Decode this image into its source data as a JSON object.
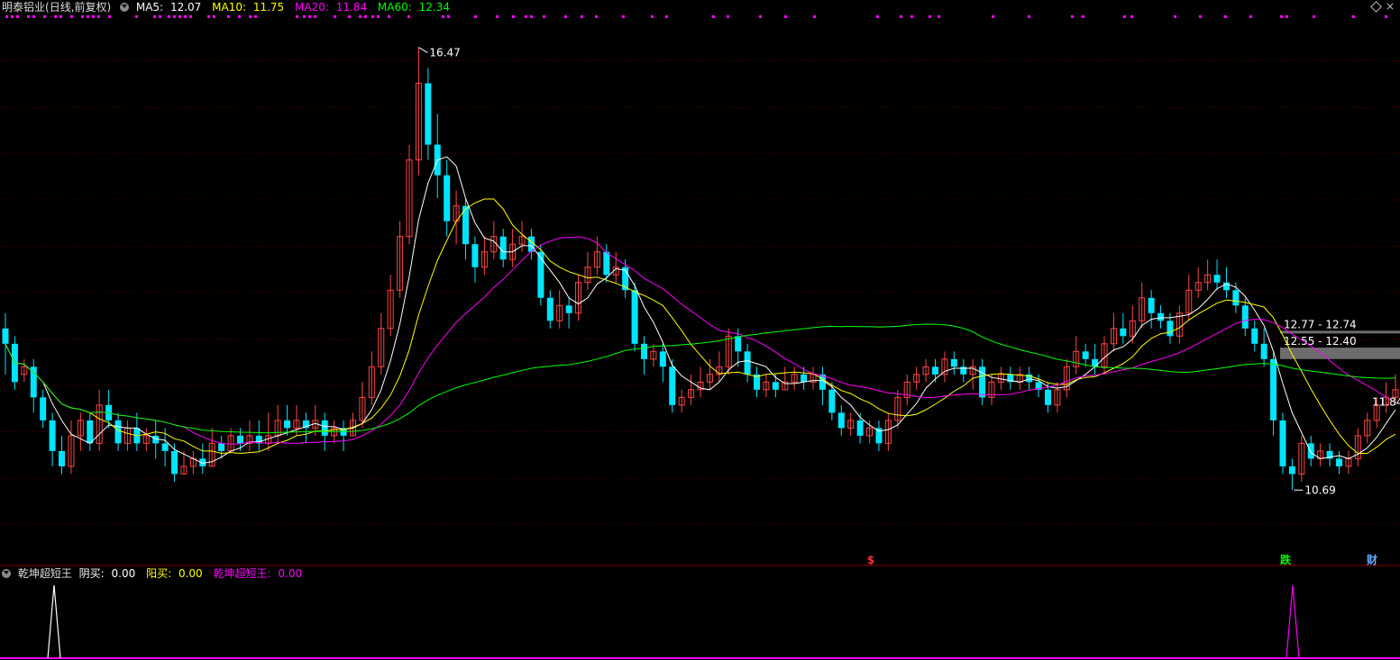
{
  "header": {
    "stock_name": "明泰铝业",
    "period": "(日线,前复权)",
    "ma5": {
      "label": "MA5:",
      "value": "12.07",
      "color": "#ffffff"
    },
    "ma10": {
      "label": "MA10:",
      "value": "11.75",
      "color": "#ffff00"
    },
    "ma20": {
      "label": "MA20:",
      "value": "11.84",
      "color": "#ff00ff"
    },
    "ma60": {
      "label": "MA60:",
      "value": "12.34",
      "color": "#00ff00"
    }
  },
  "indicator_header": {
    "name": "乾坤超短王",
    "yinmai": {
      "label": "阴买:",
      "value": "0.00",
      "color": "#ffffff"
    },
    "yangmai": {
      "label": "阳买:",
      "value": "0.00",
      "color": "#ffff00"
    },
    "qkcdw": {
      "label": "乾坤超短王:",
      "value": "0.00",
      "color": "#ff00ff"
    }
  },
  "colors": {
    "up": "#ff4444",
    "down": "#00e5ff",
    "grid": "#5a0000",
    "ma5": "#ffffff",
    "ma10": "#ffff00",
    "ma20": "#ff00ff",
    "ma60": "#00ff00",
    "dots": "#ff00ff",
    "zone": "#808080"
  },
  "chart_data": {
    "type": "candlestick",
    "y_range": [
      9.8,
      16.9
    ],
    "high_label": "16.47",
    "low_label": "10.69",
    "last_label": "11.84",
    "price_zones": [
      {
        "label": "12.77 - 12.74",
        "top": 12.77,
        "bottom": 12.74
      },
      {
        "label": "12.55 - 12.40",
        "top": 12.55,
        "bottom": 12.4
      }
    ],
    "event_markers": [
      {
        "text": "$",
        "color": "#ff3030"
      },
      {
        "text": "跌",
        "color": "#00ff00"
      },
      {
        "text": "财",
        "color": "#66aaff"
      }
    ],
    "candles": [
      [
        12.8,
        12.6,
        13.0,
        12.2
      ],
      [
        12.6,
        12.1,
        12.7,
        12.0
      ],
      [
        12.2,
        12.3,
        12.4,
        12.1
      ],
      [
        12.3,
        11.9,
        12.4,
        11.7
      ],
      [
        11.9,
        11.6,
        12.0,
        11.5
      ],
      [
        11.6,
        11.2,
        11.7,
        11.0
      ],
      [
        11.2,
        11.0,
        11.4,
        10.9
      ],
      [
        11.0,
        11.4,
        11.6,
        10.9
      ],
      [
        11.4,
        11.6,
        11.7,
        11.2
      ],
      [
        11.6,
        11.3,
        11.7,
        11.2
      ],
      [
        11.3,
        11.8,
        12.0,
        11.2
      ],
      [
        11.8,
        11.6,
        12.0,
        11.5
      ],
      [
        11.6,
        11.3,
        11.7,
        11.2
      ],
      [
        11.3,
        11.5,
        11.6,
        11.2
      ],
      [
        11.5,
        11.3,
        11.7,
        11.2
      ],
      [
        11.3,
        11.4,
        11.5,
        11.2
      ],
      [
        11.4,
        11.3,
        11.6,
        11.1
      ],
      [
        11.3,
        11.2,
        11.5,
        11.0
      ],
      [
        11.2,
        10.9,
        11.3,
        10.8
      ],
      [
        10.9,
        11.0,
        11.2,
        10.9
      ],
      [
        11.0,
        11.1,
        11.2,
        10.9
      ],
      [
        11.1,
        11.0,
        11.3,
        10.9
      ],
      [
        11.0,
        11.3,
        11.5,
        11.0
      ],
      [
        11.3,
        11.2,
        11.4,
        11.1
      ],
      [
        11.2,
        11.4,
        11.5,
        11.2
      ],
      [
        11.4,
        11.3,
        11.5,
        11.2
      ],
      [
        11.3,
        11.4,
        11.6,
        11.2
      ],
      [
        11.4,
        11.3,
        11.6,
        11.2
      ],
      [
        11.3,
        11.4,
        11.7,
        11.2
      ],
      [
        11.4,
        11.6,
        11.8,
        11.3
      ],
      [
        11.6,
        11.5,
        11.8,
        11.4
      ],
      [
        11.5,
        11.6,
        11.8,
        11.4
      ],
      [
        11.6,
        11.5,
        11.7,
        11.3
      ],
      [
        11.5,
        11.6,
        11.8,
        11.4
      ],
      [
        11.6,
        11.4,
        11.7,
        11.2
      ],
      [
        11.4,
        11.5,
        11.6,
        11.3
      ],
      [
        11.5,
        11.4,
        11.6,
        11.2
      ],
      [
        11.4,
        11.6,
        11.7,
        11.4
      ],
      [
        11.6,
        11.9,
        12.1,
        11.5
      ],
      [
        11.9,
        12.3,
        12.5,
        11.8
      ],
      [
        12.3,
        12.8,
        13.0,
        12.2
      ],
      [
        12.8,
        13.3,
        13.5,
        12.7
      ],
      [
        13.3,
        14.0,
        14.2,
        13.2
      ],
      [
        14.0,
        15.0,
        15.2,
        13.9
      ],
      [
        15.0,
        16.0,
        16.47,
        14.8
      ],
      [
        16.0,
        15.2,
        16.2,
        15.0
      ],
      [
        15.2,
        14.8,
        15.6,
        14.5
      ],
      [
        14.8,
        14.2,
        15.0,
        14.0
      ],
      [
        14.2,
        14.4,
        14.6,
        13.9
      ],
      [
        14.4,
        13.9,
        14.5,
        13.7
      ],
      [
        13.9,
        13.6,
        14.0,
        13.4
      ],
      [
        13.6,
        13.8,
        14.0,
        13.5
      ],
      [
        13.8,
        14.0,
        14.2,
        13.7
      ],
      [
        14.0,
        13.7,
        14.1,
        13.6
      ],
      [
        13.7,
        13.9,
        14.1,
        13.6
      ],
      [
        13.9,
        14.0,
        14.2,
        13.8
      ],
      [
        14.0,
        13.8,
        14.1,
        13.7
      ],
      [
        13.8,
        13.2,
        13.9,
        13.1
      ],
      [
        13.2,
        12.9,
        13.3,
        12.8
      ],
      [
        12.9,
        13.1,
        13.3,
        12.8
      ],
      [
        13.1,
        13.0,
        13.2,
        12.8
      ],
      [
        13.0,
        13.4,
        13.5,
        12.9
      ],
      [
        13.4,
        13.6,
        13.8,
        13.3
      ],
      [
        13.6,
        13.8,
        14.0,
        13.5
      ],
      [
        13.8,
        13.5,
        13.9,
        13.4
      ],
      [
        13.5,
        13.6,
        13.8,
        13.4
      ],
      [
        13.6,
        13.3,
        13.7,
        13.2
      ],
      [
        13.3,
        12.6,
        13.4,
        12.5
      ],
      [
        12.6,
        12.4,
        12.7,
        12.2
      ],
      [
        12.4,
        12.5,
        12.6,
        12.3
      ],
      [
        12.5,
        12.3,
        12.6,
        12.1
      ],
      [
        12.3,
        11.8,
        12.4,
        11.7
      ],
      [
        11.8,
        11.9,
        12.0,
        11.7
      ],
      [
        11.9,
        12.0,
        12.2,
        11.8
      ],
      [
        12.0,
        12.1,
        12.3,
        11.9
      ],
      [
        12.1,
        12.2,
        12.4,
        12.0
      ],
      [
        12.2,
        12.3,
        12.5,
        12.1
      ],
      [
        12.3,
        12.7,
        12.8,
        12.2
      ],
      [
        12.7,
        12.5,
        12.8,
        12.3
      ],
      [
        12.5,
        12.2,
        12.6,
        12.1
      ],
      [
        12.2,
        12.0,
        12.3,
        11.9
      ],
      [
        12.0,
        12.1,
        12.2,
        11.9
      ],
      [
        12.1,
        12.0,
        12.2,
        11.9
      ],
      [
        12.0,
        12.1,
        12.3,
        12.0
      ],
      [
        12.1,
        12.2,
        12.3,
        12.0
      ],
      [
        12.2,
        12.1,
        12.3,
        12.0
      ],
      [
        12.1,
        12.2,
        12.3,
        12.0
      ],
      [
        12.2,
        12.0,
        12.3,
        11.8
      ],
      [
        12.0,
        11.7,
        12.1,
        11.6
      ],
      [
        11.7,
        11.5,
        11.8,
        11.4
      ],
      [
        11.5,
        11.6,
        11.7,
        11.4
      ],
      [
        11.6,
        11.4,
        11.7,
        11.3
      ],
      [
        11.4,
        11.5,
        11.6,
        11.3
      ],
      [
        11.5,
        11.3,
        11.6,
        11.2
      ],
      [
        11.3,
        11.6,
        11.7,
        11.2
      ],
      [
        11.6,
        11.9,
        12.0,
        11.5
      ],
      [
        11.9,
        12.1,
        12.2,
        11.8
      ],
      [
        12.1,
        12.2,
        12.3,
        12.0
      ],
      [
        12.2,
        12.3,
        12.4,
        12.1
      ],
      [
        12.3,
        12.2,
        12.4,
        12.1
      ],
      [
        12.2,
        12.4,
        12.5,
        12.1
      ],
      [
        12.4,
        12.3,
        12.5,
        12.2
      ],
      [
        12.3,
        12.2,
        12.4,
        12.1
      ],
      [
        12.2,
        12.3,
        12.4,
        12.0
      ],
      [
        12.3,
        11.9,
        12.4,
        11.8
      ],
      [
        11.9,
        12.1,
        12.2,
        11.8
      ],
      [
        12.1,
        12.2,
        12.3,
        12.0
      ],
      [
        12.2,
        12.1,
        12.3,
        12.0
      ],
      [
        12.1,
        12.2,
        12.3,
        12.0
      ],
      [
        12.2,
        12.1,
        12.3,
        12.0
      ],
      [
        12.1,
        12.0,
        12.2,
        11.9
      ],
      [
        12.0,
        11.8,
        12.1,
        11.7
      ],
      [
        11.8,
        12.0,
        12.1,
        11.7
      ],
      [
        12.0,
        12.3,
        12.4,
        11.9
      ],
      [
        12.3,
        12.5,
        12.7,
        12.2
      ],
      [
        12.5,
        12.4,
        12.6,
        12.3
      ],
      [
        12.4,
        12.3,
        12.6,
        12.2
      ],
      [
        12.3,
        12.6,
        12.7,
        12.2
      ],
      [
        12.6,
        12.8,
        13.0,
        12.5
      ],
      [
        12.8,
        12.7,
        13.0,
        12.6
      ],
      [
        12.7,
        12.9,
        13.1,
        12.6
      ],
      [
        12.9,
        13.2,
        13.4,
        12.8
      ],
      [
        13.2,
        13.0,
        13.3,
        12.8
      ],
      [
        13.0,
        12.9,
        13.1,
        12.8
      ],
      [
        12.9,
        12.7,
        13.0,
        12.6
      ],
      [
        12.7,
        13.0,
        13.1,
        12.6
      ],
      [
        13.0,
        13.3,
        13.5,
        12.9
      ],
      [
        13.3,
        13.4,
        13.6,
        13.2
      ],
      [
        13.4,
        13.5,
        13.7,
        13.3
      ],
      [
        13.5,
        13.4,
        13.7,
        13.3
      ],
      [
        13.4,
        13.3,
        13.6,
        13.2
      ],
      [
        13.3,
        13.1,
        13.4,
        13.0
      ],
      [
        13.1,
        12.8,
        13.2,
        12.7
      ],
      [
        12.8,
        12.6,
        12.9,
        12.5
      ],
      [
        12.6,
        12.4,
        12.8,
        12.3
      ],
      [
        12.4,
        11.6,
        12.5,
        11.4
      ],
      [
        11.6,
        11.0,
        11.7,
        10.9
      ],
      [
        11.0,
        10.9,
        11.1,
        10.69
      ],
      [
        10.9,
        11.3,
        11.4,
        10.8
      ],
      [
        11.3,
        11.1,
        11.4,
        11.0
      ],
      [
        11.1,
        11.2,
        11.3,
        11.0
      ],
      [
        11.2,
        11.1,
        11.3,
        11.0
      ],
      [
        11.1,
        11.0,
        11.2,
        10.9
      ],
      [
        11.0,
        11.1,
        11.2,
        10.9
      ],
      [
        11.1,
        11.4,
        11.5,
        11.0
      ],
      [
        11.4,
        11.6,
        11.7,
        11.3
      ],
      [
        11.6,
        11.8,
        11.9,
        11.5
      ],
      [
        11.8,
        11.9,
        12.1,
        11.7
      ],
      [
        11.9,
        12.0,
        12.2,
        11.8
      ]
    ],
    "indicator_peaks": [
      {
        "color": "#ffffff"
      },
      {
        "color": "#ff00ff"
      }
    ]
  }
}
